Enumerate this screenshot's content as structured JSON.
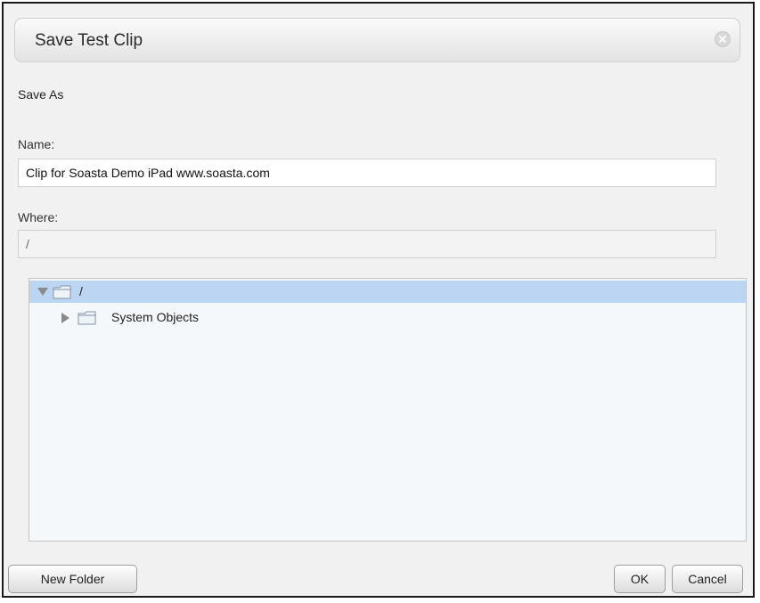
{
  "dialog": {
    "title": "Save Test Clip",
    "section_label": "Save As"
  },
  "form": {
    "name_label": "Name:",
    "name_value": "Clip for Soasta Demo iPad www.soasta.com",
    "where_label": "Where:",
    "where_value": "/"
  },
  "tree": {
    "nodes": [
      {
        "label": "/",
        "expanded": true,
        "selected": true
      },
      {
        "label": "System Objects",
        "expanded": false,
        "selected": false
      }
    ]
  },
  "buttons": {
    "new_folder": "New Folder",
    "ok": "OK",
    "cancel": "Cancel"
  },
  "colors": {
    "selection": "#bcd5f2",
    "dialog_background": "#f1f1f1"
  }
}
